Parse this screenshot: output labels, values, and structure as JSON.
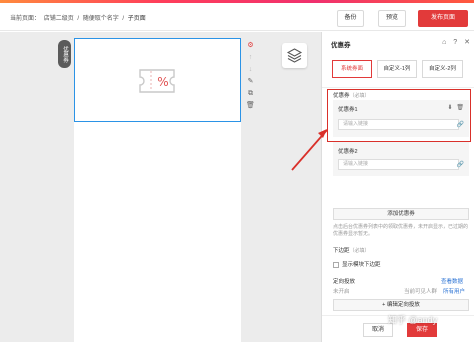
{
  "header": {
    "breadcrumbs": [
      "当前页面：",
      "店铺二级页",
      "/",
      "随便取个名字",
      "/",
      "子页面"
    ],
    "backup_label": "备份",
    "preview_label": "预览",
    "publish_label": "发布页面"
  },
  "canvas": {
    "coupon_tag": "优惠券"
  },
  "panel": {
    "title": "优惠券",
    "tabs": [
      "系统券面",
      "自定义-1列",
      "自定义-2列"
    ],
    "coupon_section_label": "优惠券",
    "coupon_section_tip": "（必填）",
    "items": [
      {
        "title": "优惠券1",
        "placeholder": "请输入链接"
      },
      {
        "title": "优惠券2",
        "placeholder": "请输入链接"
      }
    ],
    "add_coupon_label": "添加优惠券",
    "description": "点击后台优惠券列表中的领取优惠券，未开启显示，已过期的优惠券显示暂无。",
    "spacing_label": "下边距",
    "spacing_tip": "（必填）",
    "show_spacing_label": "显示模块下边距",
    "target_label": "定向投放",
    "target_link": "查看数据",
    "target_status": "未开启",
    "target_hint": "当前可见人群",
    "target_all": "所有用户",
    "edit_target_label": "+ 编辑定向投放",
    "cancel_label": "取消",
    "save_label": "保存"
  },
  "watermark": "知乎 @andy",
  "colors": {
    "accent": "#e23a3a",
    "selection": "#2b93e6",
    "highlight": "#d9302a"
  }
}
